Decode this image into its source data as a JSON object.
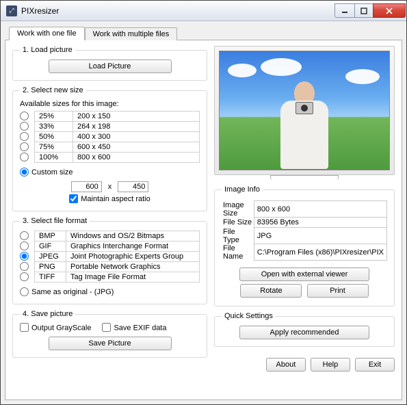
{
  "window": {
    "title": "PIXresizer"
  },
  "tabs": {
    "tab1": "Work with one file",
    "tab2": "Work with multiple files"
  },
  "section1": {
    "legend": "1. Load picture",
    "button": "Load Picture"
  },
  "section2": {
    "legend": "2. Select new size",
    "avail_label": "Available sizes for this image:",
    "rows": [
      {
        "pct": "25%",
        "dim": "200  x  150"
      },
      {
        "pct": "33%",
        "dim": "264  x  198"
      },
      {
        "pct": "50%",
        "dim": "400  x  300"
      },
      {
        "pct": "75%",
        "dim": "600  x  450"
      },
      {
        "pct": "100%",
        "dim": "800  x  600"
      }
    ],
    "custom_label": "Custom size",
    "custom_w": "600",
    "custom_h": "450",
    "x_sep": "x",
    "maintain": "Maintain aspect ratio"
  },
  "section3": {
    "legend": "3. Select file format",
    "rows": [
      {
        "ext": "BMP",
        "desc": "Windows and OS/2 Bitmaps"
      },
      {
        "ext": "GIF",
        "desc": "Graphics Interchange Format"
      },
      {
        "ext": "JPEG",
        "desc": "Joint Photographic Experts Group"
      },
      {
        "ext": "PNG",
        "desc": "Portable Network Graphics"
      },
      {
        "ext": "TIFF",
        "desc": "Tag Image File Format"
      }
    ],
    "same_label": "Same as original  - (JPG)"
  },
  "section4": {
    "legend": "4. Save picture",
    "grayscale": "Output GrayScale",
    "exif": "Save EXIF data",
    "button": "Save Picture"
  },
  "imageinfo": {
    "legend": "Image Info",
    "size_label": "Image Size",
    "size_val": "800 x 600",
    "filesize_label": "File Size",
    "filesize_val": "83956 Bytes",
    "filetype_label": "File Type",
    "filetype_val": "JPG",
    "filename_label": "File Name",
    "filename_val": "C:\\Program Files (x86)\\PIXresizer\\PIX"
  },
  "right_buttons": {
    "open_ext": "Open with external viewer",
    "rotate": "Rotate",
    "print": "Print"
  },
  "quicksettings": {
    "legend": "Quick Settings",
    "apply": "Apply recommended"
  },
  "bottom": {
    "about": "About",
    "help": "Help",
    "exit": "Exit"
  }
}
